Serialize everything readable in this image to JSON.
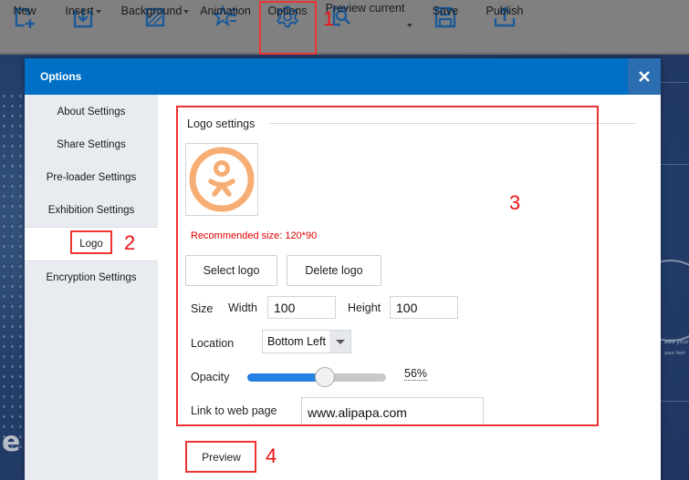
{
  "toolbar": {
    "items": [
      {
        "label": "New",
        "icon": "new-page-icon",
        "has_dropdown": false
      },
      {
        "label": "Insert",
        "icon": "insert-icon",
        "has_dropdown": true
      },
      {
        "label": "Background",
        "icon": "background-icon",
        "has_dropdown": true
      },
      {
        "label": "Animation",
        "icon": "animation-star-icon",
        "has_dropdown": false
      },
      {
        "label": "Options",
        "icon": "gear-icon",
        "has_dropdown": false
      },
      {
        "label": "Preview current",
        "icon": "preview-search-icon",
        "has_dropdown": true
      },
      {
        "label": "Save",
        "icon": "save-icon",
        "has_dropdown": false
      },
      {
        "label": "Publish",
        "icon": "publish-upload-icon",
        "has_dropdown": false
      }
    ],
    "icon_color": "#1b5a99"
  },
  "background": {
    "big_letter": "e",
    "side_text_1": "add your t",
    "side_text_2": "your text"
  },
  "dialog": {
    "title": "Options",
    "close_icon": "close-icon",
    "header_color": "#0070c6",
    "sidebar": {
      "items": [
        {
          "label": "About Settings",
          "active": false
        },
        {
          "label": "Share Settings",
          "active": false
        },
        {
          "label": "Pre-loader Settings",
          "active": false
        },
        {
          "label": "Exhibition Settings",
          "active": false
        },
        {
          "label": "Logo",
          "active": true
        },
        {
          "label": "Encryption Settings",
          "active": false
        }
      ]
    },
    "logo_settings": {
      "section_title": "Logo settings",
      "logo_icon": "odnoklassniki-logo-icon",
      "logo_color": "#f7ae74",
      "recommended_text": "Recommended size: 120*90",
      "select_logo_label": "Select logo",
      "delete_logo_label": "Delete logo",
      "size_label": "Size",
      "width_label": "Width",
      "width_value": "100",
      "height_label": "Height",
      "height_value": "100",
      "location_label": "Location",
      "location_value": "Bottom Left",
      "opacity_label": "Opacity",
      "opacity_percent": 56,
      "opacity_text": "56%",
      "link_label": "Link to web page",
      "link_value": "www.alipapa.com"
    },
    "preview_label": "Preview"
  },
  "annotations": {
    "color": "#ee3333",
    "labels": [
      "1",
      "2",
      "3",
      "4"
    ]
  }
}
